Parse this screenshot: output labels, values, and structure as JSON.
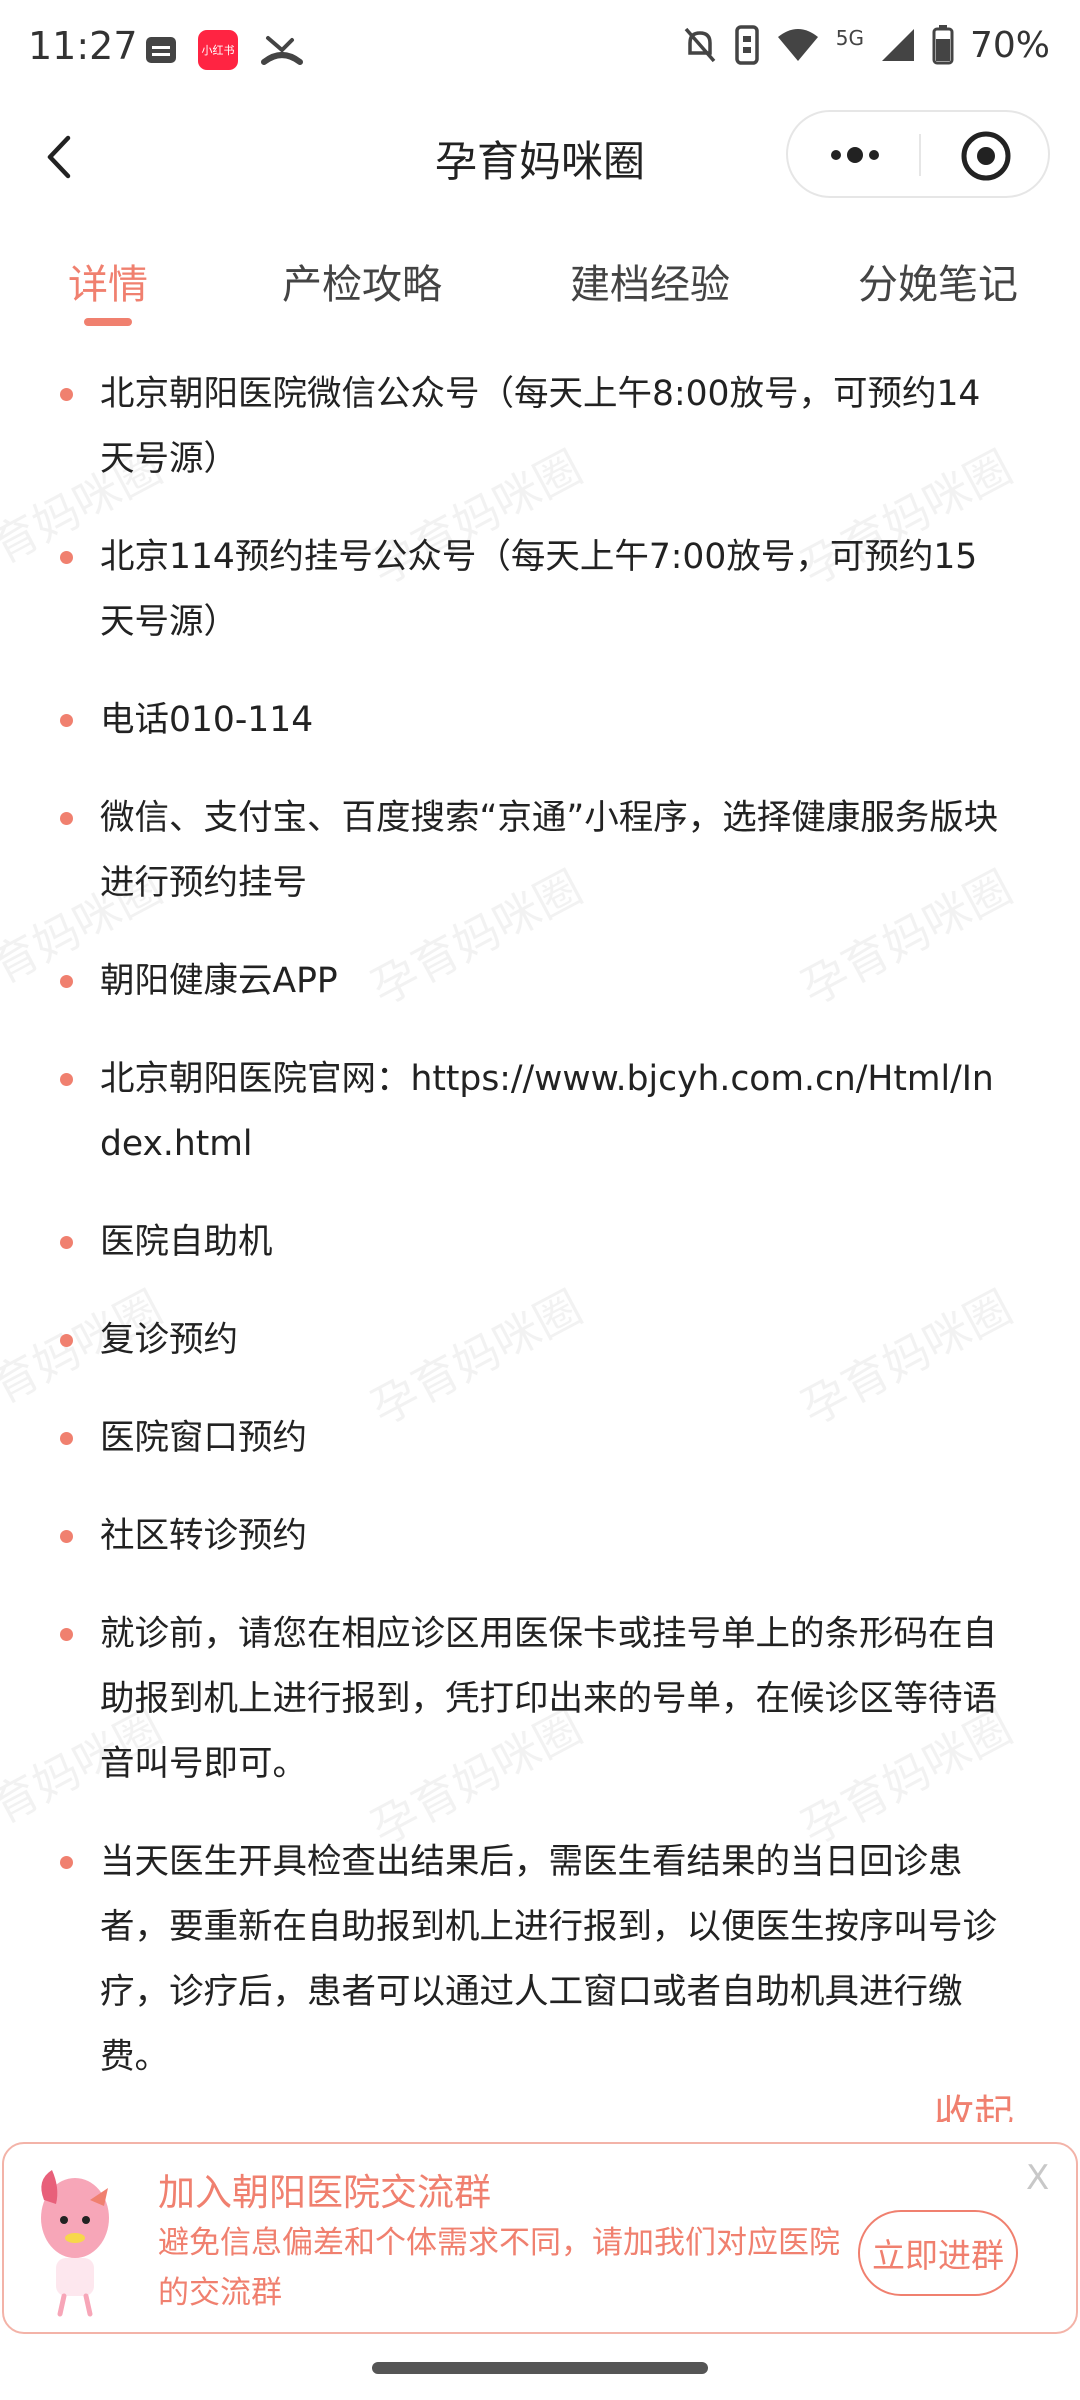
{
  "status_bar": {
    "time": "11:27",
    "xhs_label": "小红书",
    "network": "5G",
    "battery": "70%"
  },
  "nav": {
    "title": "孕育妈咪圈"
  },
  "tabs": [
    {
      "label": "详情",
      "active": true
    },
    {
      "label": "产检攻略",
      "active": false
    },
    {
      "label": "建档经验",
      "active": false
    },
    {
      "label": "分娩笔记",
      "active": false
    }
  ],
  "watermark_text": "孕育妈咪圈",
  "items": [
    "北京朝阳医院微信公众号（每天上午8:00放号，可预约14天号源）",
    "北京114预约挂号公众号（每天上午7:00放号，可预约15天号源）",
    "电话010-114",
    "微信、支付宝、百度搜索“京通”小程序，选择健康服务版块进行预约挂号",
    "朝阳健康云APP",
    "北京朝阳医院官网：https://www.bjcyh.com.cn/Html/Index.html",
    "医院自助机",
    "复诊预约",
    "医院窗口预约",
    "社区转诊预约",
    "就诊前，请您在相应诊区用医保卡或挂号单上的条形码在自助报到机上进行报到，凭打印出来的号单，在候诊区等待语音叫号即可。",
    "当天医生开具检查出结果后，需医生看结果的当日回诊患者，要重新在自助报到机上进行报到，以便医生按序叫号诊疗，诊疗后，患者可以通过人工窗口或者自助机具进行缴费。"
  ],
  "collapse_label": "收起",
  "banner": {
    "title": "加入朝阳医院交流群",
    "description": "避免信息偏差和个体需求不同，请加我们对应医院的交流群",
    "button_label": "立即进群",
    "close_label": "X"
  },
  "colors": {
    "accent": "#f0806f",
    "text": "#222222"
  }
}
